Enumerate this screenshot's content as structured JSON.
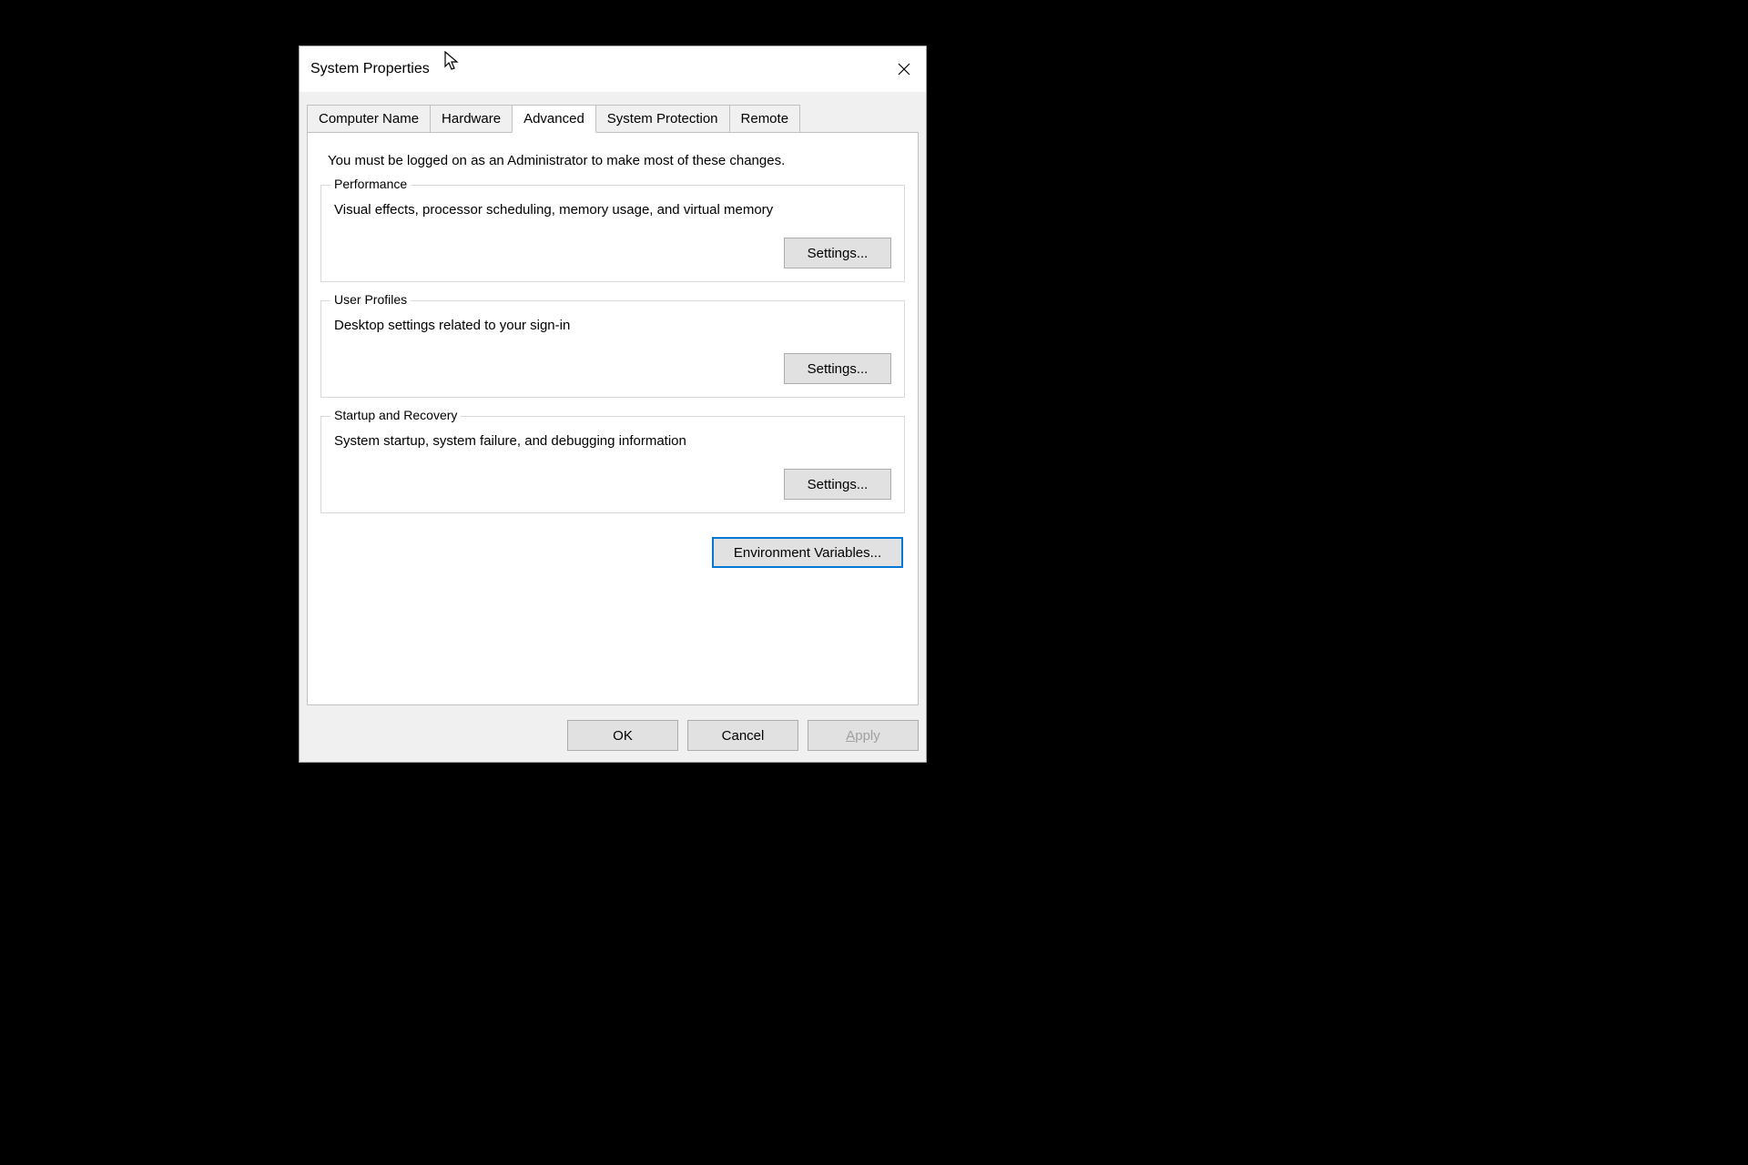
{
  "window": {
    "title": "System Properties"
  },
  "tabs": [
    {
      "label": "Computer Name"
    },
    {
      "label": "Hardware"
    },
    {
      "label": "Advanced"
    },
    {
      "label": "System Protection"
    },
    {
      "label": "Remote"
    }
  ],
  "active_tab_index": 2,
  "advanced": {
    "lead_text": "You must be logged on as an Administrator to make most of these changes.",
    "groups": [
      {
        "title": "Performance",
        "desc": "Visual effects, processor scheduling, memory usage, and virtual memory",
        "button": "Settings..."
      },
      {
        "title": "User Profiles",
        "desc": "Desktop settings related to your sign-in",
        "button": "Settings..."
      },
      {
        "title": "Startup and Recovery",
        "desc": "System startup, system failure, and debugging information",
        "button": "Settings..."
      }
    ],
    "env_button": "Environment Variables..."
  },
  "dialog_buttons": {
    "ok": "OK",
    "cancel": "Cancel",
    "apply": "Apply"
  }
}
